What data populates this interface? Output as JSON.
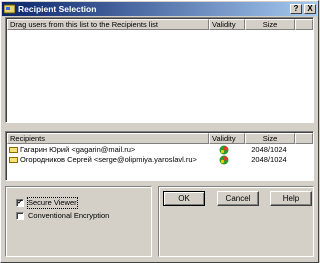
{
  "window": {
    "title": "Recipient Selection",
    "help_button": "?",
    "close_button": "X"
  },
  "top_list": {
    "columns": [
      "Drag users from this list to the Recipients list",
      "Validity",
      "Size"
    ],
    "rows": []
  },
  "recipients_list": {
    "columns": [
      "Recipients",
      "Validity",
      "Size"
    ],
    "rows": [
      {
        "name": "Гагарин Юрий <gagarin@mail.ru>",
        "validity_icon": "valid-key-icon",
        "size": "2048/1024"
      },
      {
        "name": "Огородников Сергей <serge@olipmiya.yaroslavl.ru>",
        "validity_icon": "valid-key-icon",
        "size": "2048/1024"
      }
    ]
  },
  "options": {
    "secure_viewer": {
      "label": "Secure Viewer",
      "checked": true
    },
    "conventional_encryption": {
      "label": "Conventional Encryption",
      "checked": false
    }
  },
  "buttons": {
    "ok": "OK",
    "cancel": "Cancel",
    "help": "Help"
  }
}
